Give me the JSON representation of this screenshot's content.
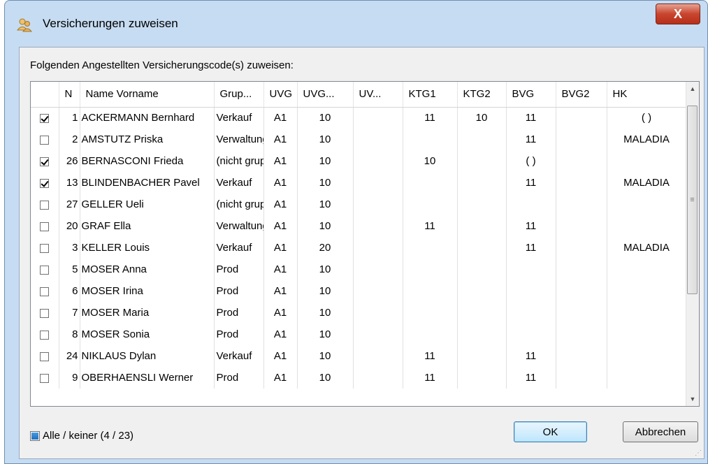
{
  "window": {
    "title": "Versicherungen zuweisen",
    "close_label": "X"
  },
  "instruction": "Folgenden Angestellten Versicherungscode(s) zuweisen:",
  "columns": [
    "",
    "N",
    "Name Vorname",
    "Grup...",
    "UVG",
    "UVG...",
    "UV...",
    "KTG1",
    "KTG2",
    "BVG",
    "BVG2",
    "HK"
  ],
  "rows": [
    {
      "checked": true,
      "n": "1",
      "name": "ACKERMANN Bernhard",
      "group": "Verkauf",
      "uvg": "A1",
      "uvg2": "10",
      "uv3": "",
      "ktg1": "11",
      "ktg2": "10",
      "bvg": "11",
      "bvg2": "",
      "hk": "( )"
    },
    {
      "checked": false,
      "n": "2",
      "name": "AMSTUTZ Priska",
      "group": "Verwaltung",
      "uvg": "A1",
      "uvg2": "10",
      "uv3": "",
      "ktg1": "",
      "ktg2": "",
      "bvg": "11",
      "bvg2": "",
      "hk": "MALADIA"
    },
    {
      "checked": true,
      "n": "26",
      "name": "BERNASCONI Frieda",
      "group": "(nicht gruppiert)",
      "uvg": "A1",
      "uvg2": "10",
      "uv3": "",
      "ktg1": "10",
      "ktg2": "",
      "bvg": "( )",
      "bvg2": "",
      "hk": ""
    },
    {
      "checked": true,
      "n": "13",
      "name": "BLINDENBACHER Pavel",
      "group": "Verkauf",
      "uvg": "A1",
      "uvg2": "10",
      "uv3": "",
      "ktg1": "",
      "ktg2": "",
      "bvg": "11",
      "bvg2": "",
      "hk": "MALADIA"
    },
    {
      "checked": false,
      "n": "27",
      "name": "GELLER Ueli",
      "group": "(nicht gruppiert)",
      "uvg": "A1",
      "uvg2": "10",
      "uv3": "",
      "ktg1": "",
      "ktg2": "",
      "bvg": "",
      "bvg2": "",
      "hk": ""
    },
    {
      "checked": false,
      "n": "20",
      "name": "GRAF Ella",
      "group": "Verwaltung",
      "uvg": "A1",
      "uvg2": "10",
      "uv3": "",
      "ktg1": "11",
      "ktg2": "",
      "bvg": "11",
      "bvg2": "",
      "hk": ""
    },
    {
      "checked": false,
      "n": "3",
      "name": "KELLER Louis",
      "group": "Verkauf",
      "uvg": "A1",
      "uvg2": "20",
      "uv3": "",
      "ktg1": "",
      "ktg2": "",
      "bvg": "11",
      "bvg2": "",
      "hk": "MALADIA"
    },
    {
      "checked": false,
      "n": "5",
      "name": "MOSER Anna",
      "group": "Prod",
      "uvg": "A1",
      "uvg2": "10",
      "uv3": "",
      "ktg1": "",
      "ktg2": "",
      "bvg": "",
      "bvg2": "",
      "hk": ""
    },
    {
      "checked": false,
      "n": "6",
      "name": "MOSER Irina",
      "group": "Prod",
      "uvg": "A1",
      "uvg2": "10",
      "uv3": "",
      "ktg1": "",
      "ktg2": "",
      "bvg": "",
      "bvg2": "",
      "hk": ""
    },
    {
      "checked": false,
      "n": "7",
      "name": "MOSER Maria",
      "group": "Prod",
      "uvg": "A1",
      "uvg2": "10",
      "uv3": "",
      "ktg1": "",
      "ktg2": "",
      "bvg": "",
      "bvg2": "",
      "hk": ""
    },
    {
      "checked": false,
      "n": "8",
      "name": "MOSER Sonia",
      "group": "Prod",
      "uvg": "A1",
      "uvg2": "10",
      "uv3": "",
      "ktg1": "",
      "ktg2": "",
      "bvg": "",
      "bvg2": "",
      "hk": ""
    },
    {
      "checked": false,
      "n": "24",
      "name": "NIKLAUS Dylan",
      "group": "Verkauf",
      "uvg": "A1",
      "uvg2": "10",
      "uv3": "",
      "ktg1": "11",
      "ktg2": "",
      "bvg": "11",
      "bvg2": "",
      "hk": ""
    },
    {
      "checked": false,
      "n": "9",
      "name": "OBERHAENSLI Werner",
      "group": "Prod",
      "uvg": "A1",
      "uvg2": "10",
      "uv3": "",
      "ktg1": "11",
      "ktg2": "",
      "bvg": "11",
      "bvg2": "",
      "hk": ""
    }
  ],
  "footer": {
    "select_all_label": "Alle / keiner (4 / 23)",
    "ok_label": "OK",
    "cancel_label": "Abbrechen"
  },
  "icons": {
    "app": "users-icon",
    "scroll_up": "chevron-up-icon",
    "scroll_down": "chevron-down-icon",
    "resize": "resize-grip-icon"
  },
  "colors": {
    "titlebar": "#c6dcf2",
    "close_button": "#c9452e",
    "ok_button": "#bee6fd"
  }
}
